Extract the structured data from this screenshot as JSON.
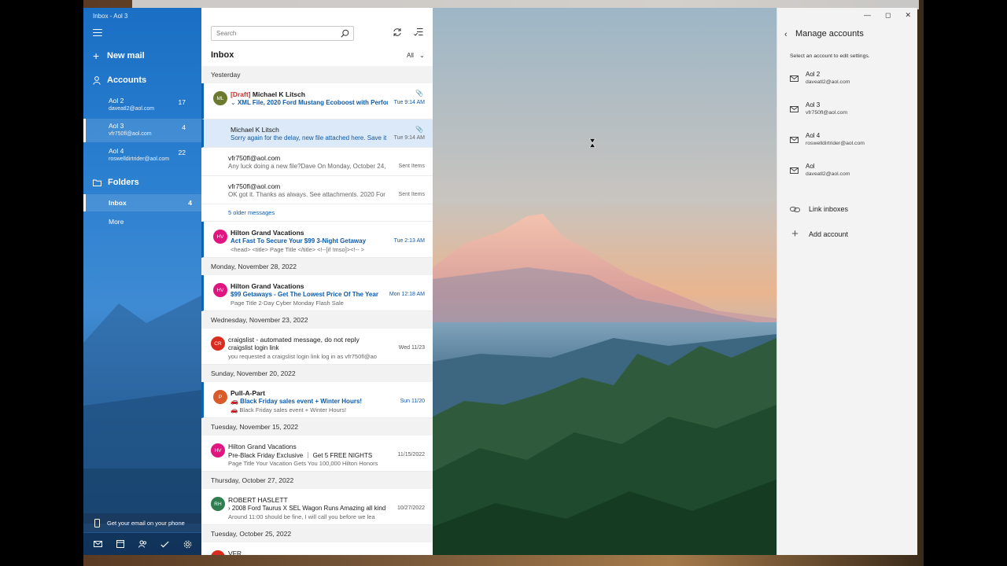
{
  "window": {
    "title": "Inbox - Aol 3"
  },
  "sidebar": {
    "new_mail": "New mail",
    "accounts_header": "Accounts",
    "accounts": [
      {
        "name": "Aol 2",
        "email": "daveatl2@aol.com",
        "count": "17"
      },
      {
        "name": "Aol 3",
        "email": "vfr750fl@aol.com",
        "count": "4"
      },
      {
        "name": "Aol 4",
        "email": "roswelldirtrider@aol.com",
        "count": "22"
      }
    ],
    "folders_header": "Folders",
    "folders": [
      {
        "name": "Inbox",
        "count": "4"
      },
      {
        "name": "More",
        "count": ""
      }
    ],
    "phone_promo": "Get your email on your phone",
    "bottom_icons": [
      "mail-icon",
      "calendar-icon",
      "people-icon",
      "todo-icon",
      "settings-icon"
    ]
  },
  "list": {
    "search_placeholder": "Search",
    "title": "Inbox",
    "filter": "All",
    "groups": [
      {
        "date": "Yesterday",
        "items": [
          {
            "type": "msg",
            "initials": "ML",
            "color": "#6b7a2e",
            "draft": "[Draft]",
            "sender": "Michael K Litsch",
            "subject": "XML File, 2020 Ford Mustang Ecoboost with Perform",
            "preview": "",
            "time": "Tue 9:14 AM",
            "attach": true,
            "unread": true,
            "expanded": true
          },
          {
            "type": "thread",
            "sender": "Michael K Litsch",
            "preview": "Sorry again for the delay, new file attached here. Save it",
            "time": "Tue 9:14 AM",
            "attach": true,
            "selected": true
          },
          {
            "type": "thread",
            "sender": "vfr750fl@aol.com",
            "preview": "Any luck doing a new file?Dave On Monday, October 24,",
            "time": "Sent Items"
          },
          {
            "type": "thread",
            "sender": "vfr750fl@aol.com",
            "preview": "OK got it. Thanks as always. See attachments. 2020 Ford M",
            "time": "Sent Items"
          },
          {
            "type": "older",
            "text": "5 older messages"
          },
          {
            "type": "msg",
            "initials": "HV",
            "color": "#e0157f",
            "sender": "Hilton Grand Vacations",
            "subject": "Act Fast To Secure Your $99 3-Night Getaway",
            "preview": "<head> <title> Page Title </title> <!--[if !mso]><!-- >",
            "time": "Tue 2:13 AM",
            "unread": true
          }
        ]
      },
      {
        "date": "Monday, November 28, 2022",
        "items": [
          {
            "type": "msg",
            "initials": "HV",
            "color": "#e0157f",
            "sender": "Hilton Grand Vacations",
            "subject": "$99 Getaways - Get The Lowest Price Of The Year",
            "preview": "Page Title 2-Day Cyber Monday Flash Sale",
            "time": "Mon 12:18 AM",
            "unread": true
          }
        ]
      },
      {
        "date": "Wednesday, November 23, 2022",
        "items": [
          {
            "type": "msg",
            "initials": "CR",
            "color": "#d92b1e",
            "sender": "craigslist - automated message, do not reply",
            "subject": "craigslist login link",
            "preview": "you requested a craigslist login link log in as vfr750fl@ao",
            "time": "Wed 11/23"
          }
        ]
      },
      {
        "date": "Sunday, November 20, 2022",
        "items": [
          {
            "type": "msg",
            "initials": "P",
            "color": "#d95b2a",
            "sender": "Pull-A-Part",
            "subject": "🚗 Black Friday sales event + Winter Hours!",
            "preview": "🚗 Black Friday sales event + Winter Hours!",
            "time": "Sun 11/20",
            "unread": true
          }
        ]
      },
      {
        "date": "Tuesday, November 15, 2022",
        "items": [
          {
            "type": "msg",
            "initials": "HV",
            "color": "#e0157f",
            "sender": "Hilton Grand Vacations",
            "subject": "Pre-Black Friday Exclusive ｜ Get 5 FREE NIGHTS",
            "preview": "Page Title Your Vacation Gets You 100,000 Hilton Honors",
            "time": "11/15/2022"
          }
        ]
      },
      {
        "date": "Thursday, October 27, 2022",
        "items": [
          {
            "type": "msg",
            "initials": "RH",
            "color": "#2e7d4f",
            "sender": "ROBERT HASLETT",
            "subject": "2008 Ford Taurus X SEL Wagon Runs Amazing all kinds",
            "preview": "Around 11:00 should be fine, I will call you before we lea",
            "time": "10/27/2022",
            "chevron": true
          }
        ]
      },
      {
        "date": "Tuesday, October 25, 2022",
        "items": [
          {
            "type": "msg",
            "initials": "",
            "color": "#d92b1e",
            "sender": "VFR",
            "subject": "",
            "preview": "",
            "time": ""
          }
        ]
      }
    ]
  },
  "flyout": {
    "title": "Manage accounts",
    "subtitle": "Select an account to edit settings.",
    "accounts": [
      {
        "name": "Aol 2",
        "email": "daveatl2@aol.com"
      },
      {
        "name": "Aol 3",
        "email": "vfr750fl@aol.com"
      },
      {
        "name": "Aol 4",
        "email": "roswelldirtrider@aol.com"
      },
      {
        "name": "Aol",
        "email": "daveatl2@aol.com"
      }
    ],
    "link_inboxes": "Link inboxes",
    "add_account": "Add account"
  }
}
